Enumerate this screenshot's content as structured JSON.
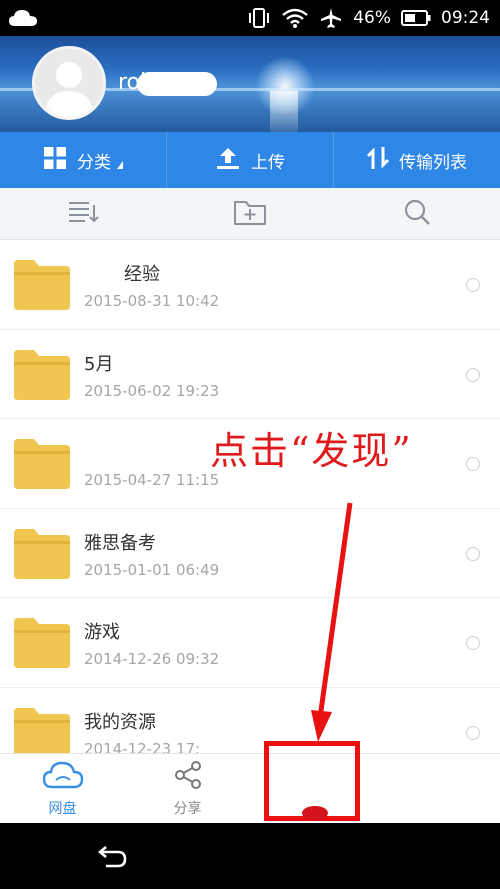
{
  "status_bar": {
    "battery": "46%",
    "time": "09:24",
    "icons": [
      "cloud-icon",
      "vibrate-icon",
      "wifi-icon",
      "airplane-icon",
      "battery-icon"
    ]
  },
  "header": {
    "username": "rol"
  },
  "action_bar": {
    "items": [
      {
        "label": "分类",
        "icon": "grid-icon"
      },
      {
        "label": "上传",
        "icon": "upload-icon"
      },
      {
        "label": "传输列表",
        "icon": "transfer-icon"
      }
    ]
  },
  "toolbar": {
    "icons": [
      "sort-list-icon",
      "new-folder-icon",
      "search-icon"
    ]
  },
  "files": [
    {
      "name": "经验",
      "date": "2015-08-31  10:42"
    },
    {
      "name": "5月",
      "date": "2015-06-02  19:23"
    },
    {
      "name": "",
      "date": "2015-04-27  11:15"
    },
    {
      "name": "雅思备考",
      "date": "2015-01-01  06:49"
    },
    {
      "name": "游戏",
      "date": "2014-12-26  09:32"
    },
    {
      "name": "我的资源",
      "date": "2014-12-23  17:"
    }
  ],
  "tab_bar": {
    "tabs": [
      {
        "label": "网盘",
        "icon": "cloud-icon",
        "active": true
      },
      {
        "label": "分享",
        "icon": "share-icon",
        "active": false
      },
      {
        "label": "",
        "icon": "discover-icon",
        "active": false
      },
      {
        "label": "",
        "icon": "more-icon",
        "active": false
      }
    ]
  },
  "annotation": {
    "text": "点击“发现”",
    "color": "#e01a1a"
  },
  "colors": {
    "accent": "#2e86e6",
    "folder": "#f0c550",
    "tab_active": "#3b8ee6"
  }
}
